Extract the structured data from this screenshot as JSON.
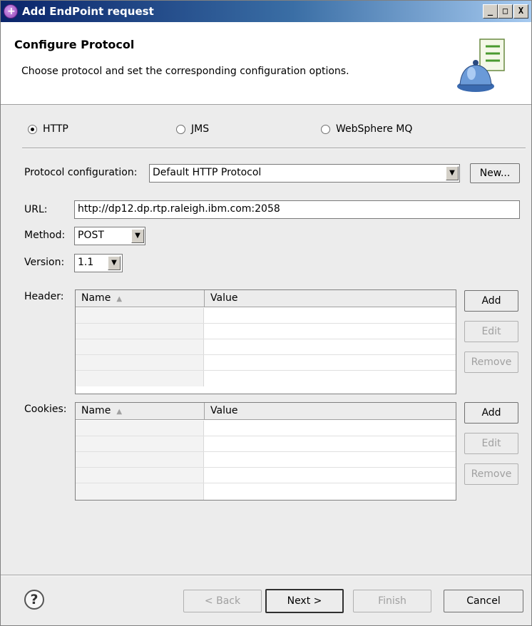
{
  "window": {
    "title": "Add EndPoint request",
    "minimize": "_",
    "maximize": "□",
    "close": "X"
  },
  "banner": {
    "title": "Configure Protocol",
    "description": "Choose protocol and set the corresponding configuration options."
  },
  "protocols": [
    {
      "label": "HTTP",
      "selected": true
    },
    {
      "label": "JMS",
      "selected": false
    },
    {
      "label": "WebSphere MQ",
      "selected": false
    }
  ],
  "protocol_configuration": {
    "label": "Protocol configuration:",
    "value": "Default HTTP Protocol",
    "new_button": "New..."
  },
  "url": {
    "label": "URL:",
    "value": "http://dp12.dp.rtp.raleigh.ibm.com:2058"
  },
  "method": {
    "label": "Method:",
    "value": "POST"
  },
  "version": {
    "label": "Version:",
    "value": "1.1"
  },
  "header": {
    "label": "Header:",
    "columns": [
      "Name",
      "Value"
    ],
    "add": "Add",
    "edit": "Edit",
    "remove": "Remove"
  },
  "cookies": {
    "label": "Cookies:",
    "columns": [
      "Name",
      "Value"
    ],
    "add": "Add",
    "edit": "Edit",
    "remove": "Remove"
  },
  "footer": {
    "back": "< Back",
    "next": "Next >",
    "finish": "Finish",
    "cancel": "Cancel",
    "help": "?"
  },
  "colors": {
    "title_bar": "#0a246a",
    "window_bg": "#ececec",
    "banner_bg": "#ffffff"
  }
}
